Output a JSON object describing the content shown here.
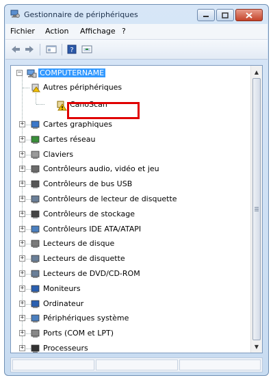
{
  "window": {
    "title": "Gestionnaire de périphériques"
  },
  "menu": [
    "Fichier",
    "Action",
    "Affichage",
    "?"
  ],
  "tree": {
    "root_label": "COMPUTERNAME",
    "other_devices_label": "Autres périphériques",
    "highlighted_device_label": "CanoScan",
    "categories": [
      "Cartes graphiques",
      "Cartes réseau",
      "Claviers",
      "Contrôleurs audio, vidéo et jeu",
      "Contrôleurs de bus USB",
      "Contrôleurs de lecteur de disquette",
      "Contrôleurs de stockage",
      "Contrôleurs IDE ATA/ATAPI",
      "Lecteurs de disque",
      "Lecteurs de disquette",
      "Lecteurs de DVD/CD-ROM",
      "Moniteurs",
      "Ordinateur",
      "Périphériques système",
      "Ports (COM et LPT)",
      "Processeurs"
    ]
  },
  "colors": {
    "selection": "#3399ff",
    "highlight_box": "#e00000",
    "warning_icon": "#f2c200"
  },
  "icons": {
    "app": "device-manager-icon",
    "back": "back-arrow-icon",
    "forward": "forward-arrow-icon",
    "properties": "properties-icon",
    "help": "help-icon",
    "view": "view-icon"
  }
}
